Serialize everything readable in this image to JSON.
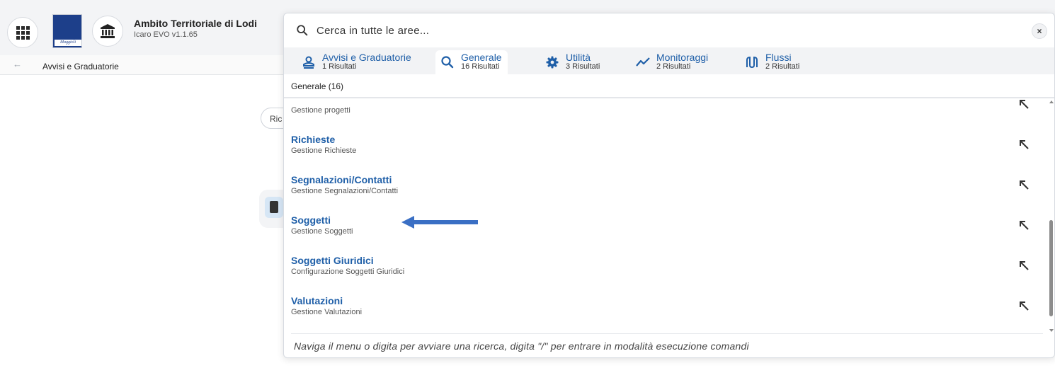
{
  "app": {
    "title": "Ambito Territoriale di Lodi",
    "version": "Icaro EVO v1.1.65",
    "logo_text": "Maggioli"
  },
  "breadcrumb": {
    "label": "Avvisi e Graduatorie"
  },
  "background": {
    "chip_text": "Ric"
  },
  "search": {
    "placeholder": "Cerca in tutte le aree...",
    "clear_label": "×"
  },
  "tabs": [
    {
      "label": "Avvisi e Graduatorie",
      "count": "1 Risultati",
      "icon": "user-badge-icon",
      "active": false
    },
    {
      "label": "Generale",
      "count": "16 Risultati",
      "icon": "search-icon",
      "active": true
    },
    {
      "label": "Utilità",
      "count": "3 Risultati",
      "icon": "gear-icon",
      "active": false
    },
    {
      "label": "Monitoraggi",
      "count": "2 Risultati",
      "icon": "trend-line-icon",
      "active": false
    },
    {
      "label": "Flussi",
      "count": "2 Risultati",
      "icon": "flow-icon",
      "active": false
    }
  ],
  "group": {
    "header": "Generale (16)"
  },
  "results": [
    {
      "title": "",
      "subtitle": "Gestione progetti"
    },
    {
      "title": "Richieste",
      "subtitle": "Gestione Richieste"
    },
    {
      "title": "Segnalazioni/Contatti",
      "subtitle": "Gestione Segnalazioni/Contatti"
    },
    {
      "title": "Soggetti",
      "subtitle": "Gestione Soggetti"
    },
    {
      "title": "Soggetti Giuridici",
      "subtitle": "Configurazione Soggetti Giuridici"
    },
    {
      "title": "Valutazioni",
      "subtitle": "Gestione Valutazioni"
    }
  ],
  "footer": {
    "hint": "Naviga il menu o digita per avviare una ricerca, digita \"/\" per entrare in modalità esecuzione comandi"
  },
  "colors": {
    "accent": "#1f5fa8",
    "annotation_arrow": "#3a6fc4"
  }
}
